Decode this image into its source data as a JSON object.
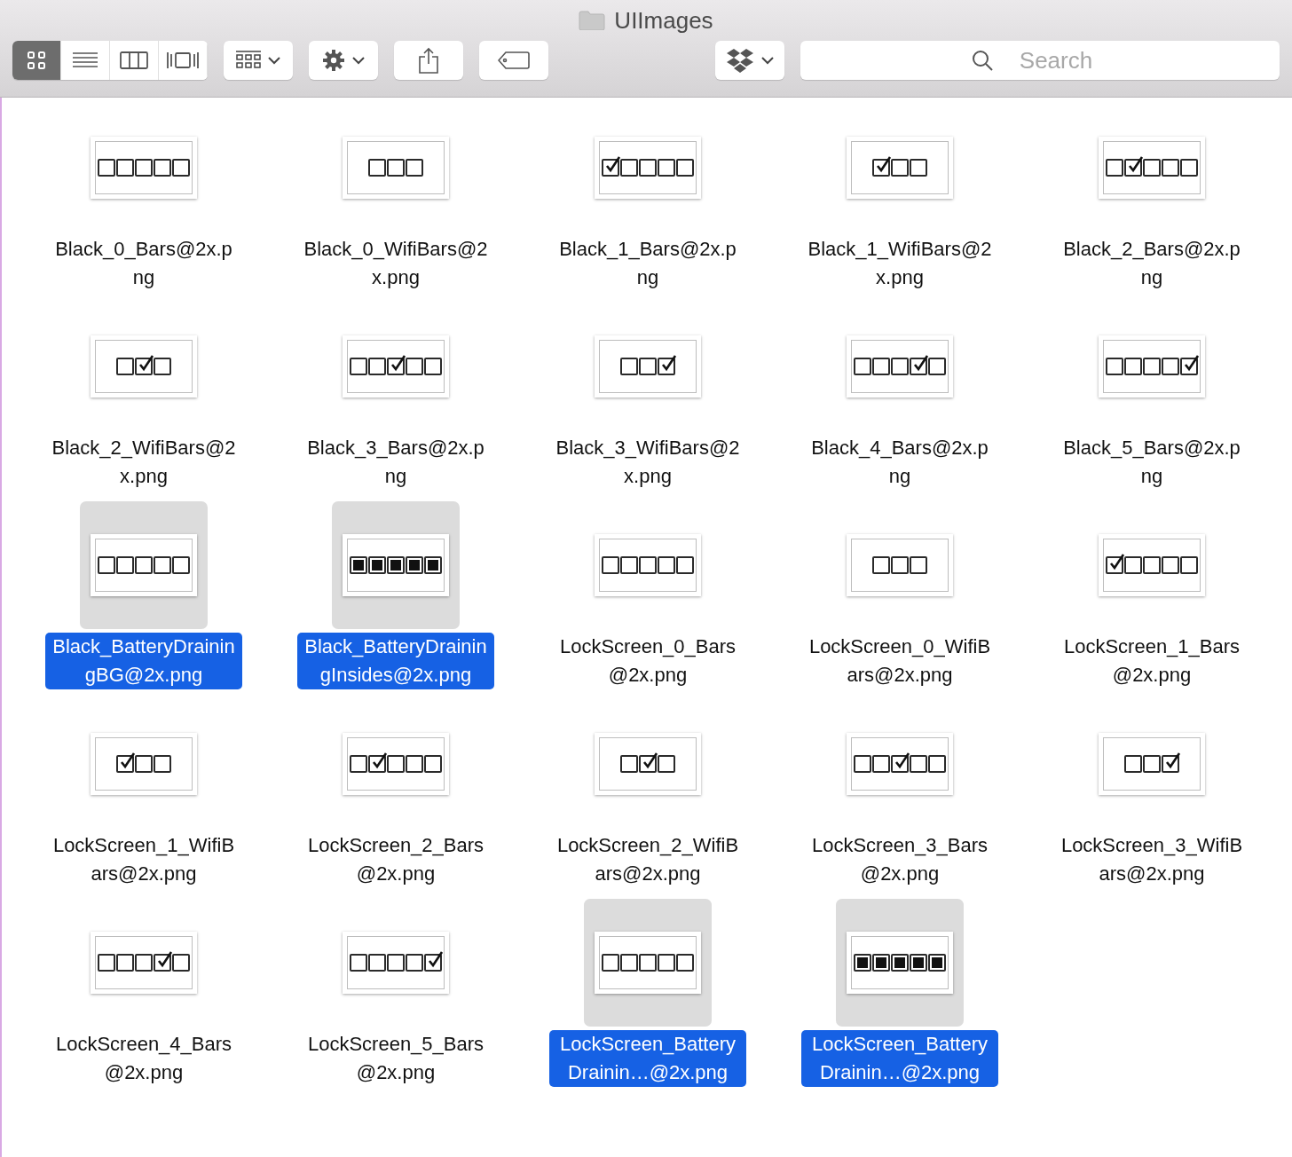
{
  "window": {
    "title": "UIImages"
  },
  "toolbar": {
    "view_modes": [
      {
        "kind": "icons",
        "selected": true
      },
      {
        "kind": "list",
        "selected": false
      },
      {
        "kind": "columns",
        "selected": false
      },
      {
        "kind": "coverflow",
        "selected": false
      }
    ],
    "search": {
      "placeholder": "Search"
    }
  },
  "files": [
    {
      "name": "Black_0_Bars@2x.png",
      "selected": false,
      "thumbnail": [
        {
          "checked": false,
          "filled": false
        },
        {
          "checked": false,
          "filled": false
        },
        {
          "checked": false,
          "filled": false
        },
        {
          "checked": false,
          "filled": false
        },
        {
          "checked": false,
          "filled": false
        }
      ]
    },
    {
      "name": "Black_0_WifiBars@2x.png",
      "selected": false,
      "thumbnail": [
        {
          "checked": false,
          "filled": false
        },
        {
          "checked": false,
          "filled": false
        },
        {
          "checked": false,
          "filled": false
        }
      ]
    },
    {
      "name": "Black_1_Bars@2x.png",
      "selected": false,
      "thumbnail": [
        {
          "checked": true,
          "filled": false
        },
        {
          "checked": false,
          "filled": false
        },
        {
          "checked": false,
          "filled": false
        },
        {
          "checked": false,
          "filled": false
        },
        {
          "checked": false,
          "filled": false
        }
      ]
    },
    {
      "name": "Black_1_WifiBars@2x.png",
      "selected": false,
      "thumbnail": [
        {
          "checked": true,
          "filled": false
        },
        {
          "checked": false,
          "filled": false
        },
        {
          "checked": false,
          "filled": false
        }
      ]
    },
    {
      "name": "Black_2_Bars@2x.png",
      "selected": false,
      "thumbnail": [
        {
          "checked": false,
          "filled": false
        },
        {
          "checked": true,
          "filled": false
        },
        {
          "checked": false,
          "filled": false
        },
        {
          "checked": false,
          "filled": false
        },
        {
          "checked": false,
          "filled": false
        }
      ]
    },
    {
      "name": "Black_2_WifiBars@2x.png",
      "selected": false,
      "thumbnail": [
        {
          "checked": false,
          "filled": false
        },
        {
          "checked": true,
          "filled": false
        },
        {
          "checked": false,
          "filled": false
        }
      ]
    },
    {
      "name": "Black_3_Bars@2x.png",
      "selected": false,
      "thumbnail": [
        {
          "checked": false,
          "filled": false
        },
        {
          "checked": false,
          "filled": false
        },
        {
          "checked": true,
          "filled": false
        },
        {
          "checked": false,
          "filled": false
        },
        {
          "checked": false,
          "filled": false
        }
      ]
    },
    {
      "name": "Black_3_WifiBars@2x.png",
      "selected": false,
      "thumbnail": [
        {
          "checked": false,
          "filled": false
        },
        {
          "checked": false,
          "filled": false
        },
        {
          "checked": true,
          "filled": false
        }
      ]
    },
    {
      "name": "Black_4_Bars@2x.png",
      "selected": false,
      "thumbnail": [
        {
          "checked": false,
          "filled": false
        },
        {
          "checked": false,
          "filled": false
        },
        {
          "checked": false,
          "filled": false
        },
        {
          "checked": true,
          "filled": false
        },
        {
          "checked": false,
          "filled": false
        }
      ]
    },
    {
      "name": "Black_5_Bars@2x.png",
      "selected": false,
      "thumbnail": [
        {
          "checked": false,
          "filled": false
        },
        {
          "checked": false,
          "filled": false
        },
        {
          "checked": false,
          "filled": false
        },
        {
          "checked": false,
          "filled": false
        },
        {
          "checked": true,
          "filled": false
        }
      ]
    },
    {
      "name": "Black_BatteryDrainingBG@2x.png",
      "selected": true,
      "thumbnail": [
        {
          "checked": false,
          "filled": false
        },
        {
          "checked": false,
          "filled": false
        },
        {
          "checked": false,
          "filled": false
        },
        {
          "checked": false,
          "filled": false
        },
        {
          "checked": false,
          "filled": false
        }
      ]
    },
    {
      "name": "Black_BatteryDrainingInsides@2x.png",
      "selected": true,
      "thumbnail": [
        {
          "checked": false,
          "filled": true
        },
        {
          "checked": false,
          "filled": true
        },
        {
          "checked": false,
          "filled": true
        },
        {
          "checked": false,
          "filled": true
        },
        {
          "checked": false,
          "filled": true
        }
      ]
    },
    {
      "name": "LockScreen_0_Bars@2x.png",
      "selected": false,
      "thumbnail": [
        {
          "checked": false,
          "filled": false
        },
        {
          "checked": false,
          "filled": false
        },
        {
          "checked": false,
          "filled": false
        },
        {
          "checked": false,
          "filled": false
        },
        {
          "checked": false,
          "filled": false
        }
      ]
    },
    {
      "name": "LockScreen_0_WifiBars@2x.png",
      "selected": false,
      "thumbnail": [
        {
          "checked": false,
          "filled": false
        },
        {
          "checked": false,
          "filled": false
        },
        {
          "checked": false,
          "filled": false
        }
      ]
    },
    {
      "name": "LockScreen_1_Bars@2x.png",
      "selected": false,
      "thumbnail": [
        {
          "checked": true,
          "filled": false
        },
        {
          "checked": false,
          "filled": false
        },
        {
          "checked": false,
          "filled": false
        },
        {
          "checked": false,
          "filled": false
        },
        {
          "checked": false,
          "filled": false
        }
      ]
    },
    {
      "name": "LockScreen_1_WifiBars@2x.png",
      "selected": false,
      "thumbnail": [
        {
          "checked": true,
          "filled": false
        },
        {
          "checked": false,
          "filled": false
        },
        {
          "checked": false,
          "filled": false
        }
      ]
    },
    {
      "name": "LockScreen_2_Bars@2x.png",
      "selected": false,
      "thumbnail": [
        {
          "checked": false,
          "filled": false
        },
        {
          "checked": true,
          "filled": false
        },
        {
          "checked": false,
          "filled": false
        },
        {
          "checked": false,
          "filled": false
        },
        {
          "checked": false,
          "filled": false
        }
      ]
    },
    {
      "name": "LockScreen_2_WifiBars@2x.png",
      "selected": false,
      "thumbnail": [
        {
          "checked": false,
          "filled": false
        },
        {
          "checked": true,
          "filled": false
        },
        {
          "checked": false,
          "filled": false
        }
      ]
    },
    {
      "name": "LockScreen_3_Bars@2x.png",
      "selected": false,
      "thumbnail": [
        {
          "checked": false,
          "filled": false
        },
        {
          "checked": false,
          "filled": false
        },
        {
          "checked": true,
          "filled": false
        },
        {
          "checked": false,
          "filled": false
        },
        {
          "checked": false,
          "filled": false
        }
      ]
    },
    {
      "name": "LockScreen_3_WifiBars@2x.png",
      "selected": false,
      "thumbnail": [
        {
          "checked": false,
          "filled": false
        },
        {
          "checked": false,
          "filled": false
        },
        {
          "checked": true,
          "filled": false
        }
      ]
    },
    {
      "name": "LockScreen_4_Bars@2x.png",
      "selected": false,
      "thumbnail": [
        {
          "checked": false,
          "filled": false
        },
        {
          "checked": false,
          "filled": false
        },
        {
          "checked": false,
          "filled": false
        },
        {
          "checked": true,
          "filled": false
        },
        {
          "checked": false,
          "filled": false
        }
      ]
    },
    {
      "name": "LockScreen_5_Bars@2x.png",
      "selected": false,
      "thumbnail": [
        {
          "checked": false,
          "filled": false
        },
        {
          "checked": false,
          "filled": false
        },
        {
          "checked": false,
          "filled": false
        },
        {
          "checked": false,
          "filled": false
        },
        {
          "checked": true,
          "filled": false
        }
      ]
    },
    {
      "name": "LockScreen_BatteryDrainin…@2x.png",
      "selected": true,
      "thumbnail": [
        {
          "checked": false,
          "filled": false
        },
        {
          "checked": false,
          "filled": false
        },
        {
          "checked": false,
          "filled": false
        },
        {
          "checked": false,
          "filled": false
        },
        {
          "checked": false,
          "filled": false
        }
      ]
    },
    {
      "name": "LockScreen_BatteryDrainin…@2x.png",
      "selected": true,
      "thumbnail": [
        {
          "checked": false,
          "filled": true
        },
        {
          "checked": false,
          "filled": true
        },
        {
          "checked": false,
          "filled": true
        },
        {
          "checked": false,
          "filled": true
        },
        {
          "checked": false,
          "filled": true
        }
      ]
    }
  ]
}
